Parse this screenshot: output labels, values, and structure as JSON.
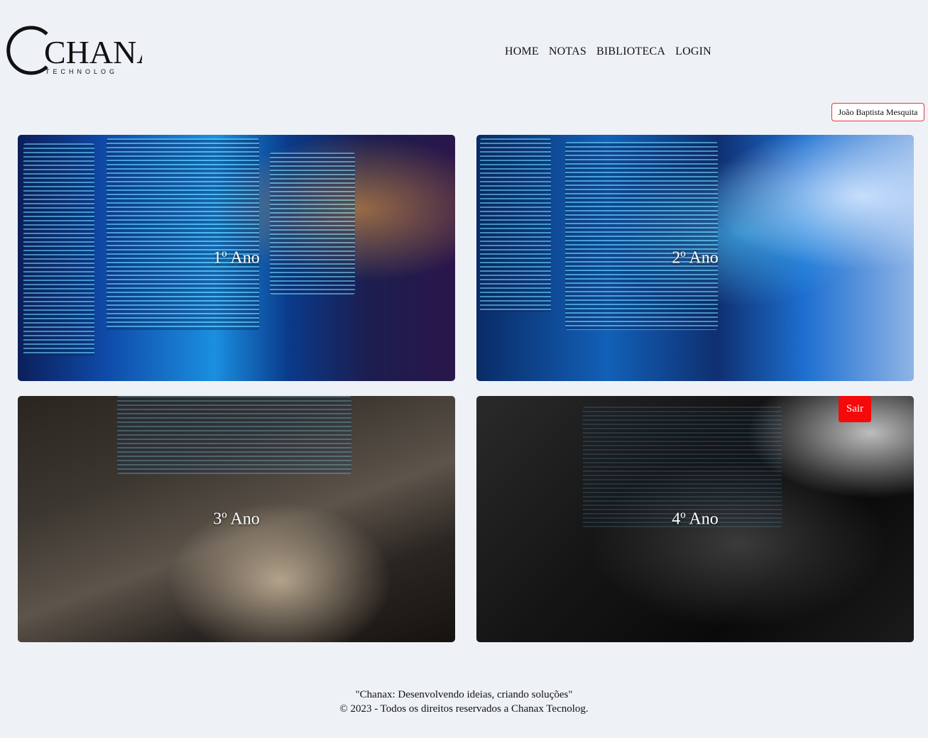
{
  "header": {
    "logo": {
      "name": "CHANAX",
      "sub": "TECHNOLOG"
    },
    "nav": [
      "HOME",
      "NOTAS",
      "BIBLIOTECA",
      "LOGIN"
    ]
  },
  "user": {
    "name": "João Baptista Mesquita"
  },
  "cards": [
    {
      "label": "1º Ano"
    },
    {
      "label": "2º Ano"
    },
    {
      "label": "3º Ano"
    },
    {
      "label": "4º Ano"
    }
  ],
  "logout_label": "Sair",
  "footer": {
    "quote": "\"Chanax: Desenvolvendo ideias, criando soluções\"",
    "copyright": "© 2023 - Todos os direitos reservados a Chanax Tecnolog."
  },
  "colors": {
    "background": "#eef2f7",
    "accent": "#f40a0a"
  }
}
